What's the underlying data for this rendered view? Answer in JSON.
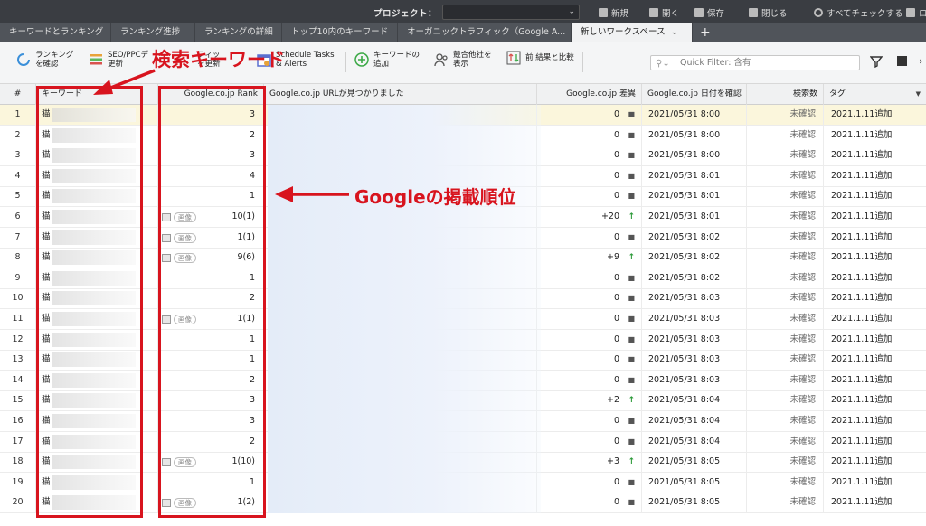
{
  "topbar": {
    "project_label": "プロジェクト：",
    "project_value": "",
    "buttons": [
      {
        "label": "新規",
        "icon": "new-file-icon"
      },
      {
        "label": "開く",
        "icon": "open-folder-icon"
      },
      {
        "label": "保存",
        "icon": "save-icon"
      },
      {
        "label": "閉じる",
        "icon": "close-icon"
      },
      {
        "label": "すべてチェックする",
        "icon": "refresh-icon"
      },
      {
        "label": "ロ",
        "icon": "login-icon"
      }
    ]
  },
  "tabs": [
    {
      "label": "キーワードとランキング"
    },
    {
      "label": "ランキング進捗"
    },
    {
      "label": "ランキングの詳細"
    },
    {
      "label": "トップ10内のキーワード"
    },
    {
      "label": "オーガニックトラフィック（Google A..."
    },
    {
      "label": "新しいワークスペース",
      "active": true
    }
  ],
  "toolbar": {
    "check_rankings": "ランキング\nを確認",
    "seo_update": "SEO/PPCデ\n更新",
    "traffic_update": "フィッ\nを更新",
    "schedule": "Schedule Tasks\n& Alerts",
    "add_keyword": "キーワードの\n追加",
    "competitors": "競合他社を\n表示",
    "compare": "前 結果と比較",
    "filter_placeholder": "Quick Filter: 含有"
  },
  "columns": {
    "num": "#",
    "keyword": "キーワード",
    "rank": "Google.co.jp Rank",
    "url": "Google.co.jp URLが見つかりました",
    "diff": "Google.co.jp 差異",
    "date": "Google.co.jp 日付を確認",
    "volume": "検索数",
    "tag": "タグ"
  },
  "rows": [
    {
      "num": "1",
      "kw": "猫",
      "rank": "3",
      "img": false,
      "diff": "0",
      "trend": "flat",
      "date": "2021/05/31 8:00",
      "vol": "未確認",
      "tag": "2021.1.11追加"
    },
    {
      "num": "2",
      "kw": "猫",
      "rank": "2",
      "img": false,
      "diff": "0",
      "trend": "flat",
      "date": "2021/05/31 8:00",
      "vol": "未確認",
      "tag": "2021.1.11追加"
    },
    {
      "num": "3",
      "kw": "猫",
      "rank": "3",
      "img": false,
      "diff": "0",
      "trend": "flat",
      "date": "2021/05/31 8:00",
      "vol": "未確認",
      "tag": "2021.1.11追加"
    },
    {
      "num": "4",
      "kw": "猫",
      "rank": "4",
      "img": false,
      "diff": "0",
      "trend": "flat",
      "date": "2021/05/31 8:01",
      "vol": "未確認",
      "tag": "2021.1.11追加"
    },
    {
      "num": "5",
      "kw": "猫",
      "rank": "1",
      "img": false,
      "diff": "0",
      "trend": "flat",
      "date": "2021/05/31 8:01",
      "vol": "未確認",
      "tag": "2021.1.11追加"
    },
    {
      "num": "6",
      "kw": "猫",
      "rank": "10(1)",
      "img": true,
      "diff": "+20",
      "trend": "up",
      "date": "2021/05/31 8:01",
      "vol": "未確認",
      "tag": "2021.1.11追加"
    },
    {
      "num": "7",
      "kw": "猫",
      "rank": "1(1)",
      "img": true,
      "diff": "0",
      "trend": "flat",
      "date": "2021/05/31 8:02",
      "vol": "未確認",
      "tag": "2021.1.11追加"
    },
    {
      "num": "8",
      "kw": "猫",
      "rank": "9(6)",
      "img": true,
      "diff": "+9",
      "trend": "up",
      "date": "2021/05/31 8:02",
      "vol": "未確認",
      "tag": "2021.1.11追加"
    },
    {
      "num": "9",
      "kw": "猫",
      "rank": "1",
      "img": false,
      "diff": "0",
      "trend": "flat",
      "date": "2021/05/31 8:02",
      "vol": "未確認",
      "tag": "2021.1.11追加"
    },
    {
      "num": "10",
      "kw": "猫",
      "rank": "2",
      "img": false,
      "diff": "0",
      "trend": "flat",
      "date": "2021/05/31 8:03",
      "vol": "未確認",
      "tag": "2021.1.11追加"
    },
    {
      "num": "11",
      "kw": "猫",
      "rank": "1(1)",
      "img": true,
      "diff": "0",
      "trend": "flat",
      "date": "2021/05/31 8:03",
      "vol": "未確認",
      "tag": "2021.1.11追加"
    },
    {
      "num": "12",
      "kw": "猫",
      "rank": "1",
      "img": false,
      "diff": "0",
      "trend": "flat",
      "date": "2021/05/31 8:03",
      "vol": "未確認",
      "tag": "2021.1.11追加"
    },
    {
      "num": "13",
      "kw": "猫",
      "rank": "1",
      "img": false,
      "diff": "0",
      "trend": "flat",
      "date": "2021/05/31 8:03",
      "vol": "未確認",
      "tag": "2021.1.11追加"
    },
    {
      "num": "14",
      "kw": "猫",
      "rank": "2",
      "img": false,
      "diff": "0",
      "trend": "flat",
      "date": "2021/05/31 8:03",
      "vol": "未確認",
      "tag": "2021.1.11追加"
    },
    {
      "num": "15",
      "kw": "猫",
      "rank": "3",
      "img": false,
      "diff": "+2",
      "trend": "up",
      "date": "2021/05/31 8:04",
      "vol": "未確認",
      "tag": "2021.1.11追加"
    },
    {
      "num": "16",
      "kw": "猫",
      "rank": "3",
      "img": false,
      "diff": "0",
      "trend": "flat",
      "date": "2021/05/31 8:04",
      "vol": "未確認",
      "tag": "2021.1.11追加"
    },
    {
      "num": "17",
      "kw": "猫",
      "rank": "2",
      "img": false,
      "diff": "0",
      "trend": "flat",
      "date": "2021/05/31 8:04",
      "vol": "未確認",
      "tag": "2021.1.11追加"
    },
    {
      "num": "18",
      "kw": "猫",
      "rank": "1(10)",
      "img": true,
      "diff": "+3",
      "trend": "up",
      "date": "2021/05/31 8:05",
      "vol": "未確認",
      "tag": "2021.1.11追加"
    },
    {
      "num": "19",
      "kw": "猫",
      "rank": "1",
      "img": false,
      "diff": "0",
      "trend": "flat",
      "date": "2021/05/31 8:05",
      "vol": "未確認",
      "tag": "2021.1.11追加"
    },
    {
      "num": "20",
      "kw": "猫",
      "rank": "1(2)",
      "img": true,
      "diff": "0",
      "trend": "flat",
      "date": "2021/05/31 8:05",
      "vol": "未確認",
      "tag": "2021.1.11追加"
    }
  ],
  "image_badge": "画像",
  "annotations": {
    "keyword_label": "検索キーワード",
    "rank_label": "Googleの掲載順位"
  },
  "colors": {
    "annotation": "#d8141e",
    "selected_row": "#fbf6dc",
    "trend_up": "#2d9a3a"
  }
}
